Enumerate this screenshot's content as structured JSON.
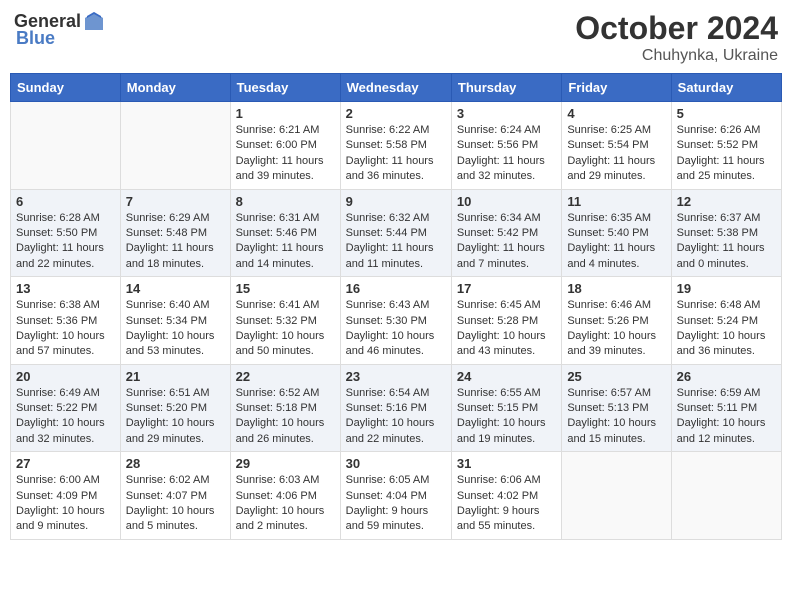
{
  "header": {
    "logo_general": "General",
    "logo_blue": "Blue",
    "month": "October 2024",
    "location": "Chuhynka, Ukraine"
  },
  "weekdays": [
    "Sunday",
    "Monday",
    "Tuesday",
    "Wednesday",
    "Thursday",
    "Friday",
    "Saturday"
  ],
  "weeks": [
    [
      {
        "day": "",
        "info": ""
      },
      {
        "day": "",
        "info": ""
      },
      {
        "day": "1",
        "info": "Sunrise: 6:21 AM\nSunset: 6:00 PM\nDaylight: 11 hours and 39 minutes."
      },
      {
        "day": "2",
        "info": "Sunrise: 6:22 AM\nSunset: 5:58 PM\nDaylight: 11 hours and 36 minutes."
      },
      {
        "day": "3",
        "info": "Sunrise: 6:24 AM\nSunset: 5:56 PM\nDaylight: 11 hours and 32 minutes."
      },
      {
        "day": "4",
        "info": "Sunrise: 6:25 AM\nSunset: 5:54 PM\nDaylight: 11 hours and 29 minutes."
      },
      {
        "day": "5",
        "info": "Sunrise: 6:26 AM\nSunset: 5:52 PM\nDaylight: 11 hours and 25 minutes."
      }
    ],
    [
      {
        "day": "6",
        "info": "Sunrise: 6:28 AM\nSunset: 5:50 PM\nDaylight: 11 hours and 22 minutes."
      },
      {
        "day": "7",
        "info": "Sunrise: 6:29 AM\nSunset: 5:48 PM\nDaylight: 11 hours and 18 minutes."
      },
      {
        "day": "8",
        "info": "Sunrise: 6:31 AM\nSunset: 5:46 PM\nDaylight: 11 hours and 14 minutes."
      },
      {
        "day": "9",
        "info": "Sunrise: 6:32 AM\nSunset: 5:44 PM\nDaylight: 11 hours and 11 minutes."
      },
      {
        "day": "10",
        "info": "Sunrise: 6:34 AM\nSunset: 5:42 PM\nDaylight: 11 hours and 7 minutes."
      },
      {
        "day": "11",
        "info": "Sunrise: 6:35 AM\nSunset: 5:40 PM\nDaylight: 11 hours and 4 minutes."
      },
      {
        "day": "12",
        "info": "Sunrise: 6:37 AM\nSunset: 5:38 PM\nDaylight: 11 hours and 0 minutes."
      }
    ],
    [
      {
        "day": "13",
        "info": "Sunrise: 6:38 AM\nSunset: 5:36 PM\nDaylight: 10 hours and 57 minutes."
      },
      {
        "day": "14",
        "info": "Sunrise: 6:40 AM\nSunset: 5:34 PM\nDaylight: 10 hours and 53 minutes."
      },
      {
        "day": "15",
        "info": "Sunrise: 6:41 AM\nSunset: 5:32 PM\nDaylight: 10 hours and 50 minutes."
      },
      {
        "day": "16",
        "info": "Sunrise: 6:43 AM\nSunset: 5:30 PM\nDaylight: 10 hours and 46 minutes."
      },
      {
        "day": "17",
        "info": "Sunrise: 6:45 AM\nSunset: 5:28 PM\nDaylight: 10 hours and 43 minutes."
      },
      {
        "day": "18",
        "info": "Sunrise: 6:46 AM\nSunset: 5:26 PM\nDaylight: 10 hours and 39 minutes."
      },
      {
        "day": "19",
        "info": "Sunrise: 6:48 AM\nSunset: 5:24 PM\nDaylight: 10 hours and 36 minutes."
      }
    ],
    [
      {
        "day": "20",
        "info": "Sunrise: 6:49 AM\nSunset: 5:22 PM\nDaylight: 10 hours and 32 minutes."
      },
      {
        "day": "21",
        "info": "Sunrise: 6:51 AM\nSunset: 5:20 PM\nDaylight: 10 hours and 29 minutes."
      },
      {
        "day": "22",
        "info": "Sunrise: 6:52 AM\nSunset: 5:18 PM\nDaylight: 10 hours and 26 minutes."
      },
      {
        "day": "23",
        "info": "Sunrise: 6:54 AM\nSunset: 5:16 PM\nDaylight: 10 hours and 22 minutes."
      },
      {
        "day": "24",
        "info": "Sunrise: 6:55 AM\nSunset: 5:15 PM\nDaylight: 10 hours and 19 minutes."
      },
      {
        "day": "25",
        "info": "Sunrise: 6:57 AM\nSunset: 5:13 PM\nDaylight: 10 hours and 15 minutes."
      },
      {
        "day": "26",
        "info": "Sunrise: 6:59 AM\nSunset: 5:11 PM\nDaylight: 10 hours and 12 minutes."
      }
    ],
    [
      {
        "day": "27",
        "info": "Sunrise: 6:00 AM\nSunset: 4:09 PM\nDaylight: 10 hours and 9 minutes."
      },
      {
        "day": "28",
        "info": "Sunrise: 6:02 AM\nSunset: 4:07 PM\nDaylight: 10 hours and 5 minutes."
      },
      {
        "day": "29",
        "info": "Sunrise: 6:03 AM\nSunset: 4:06 PM\nDaylight: 10 hours and 2 minutes."
      },
      {
        "day": "30",
        "info": "Sunrise: 6:05 AM\nSunset: 4:04 PM\nDaylight: 9 hours and 59 minutes."
      },
      {
        "day": "31",
        "info": "Sunrise: 6:06 AM\nSunset: 4:02 PM\nDaylight: 9 hours and 55 minutes."
      },
      {
        "day": "",
        "info": ""
      },
      {
        "day": "",
        "info": ""
      }
    ]
  ]
}
